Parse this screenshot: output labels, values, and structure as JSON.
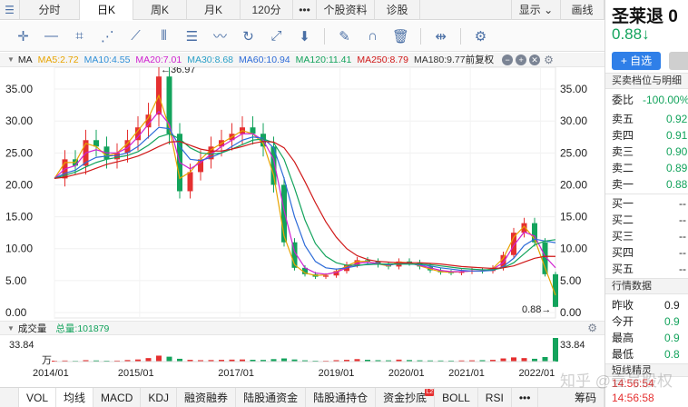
{
  "period_tabs": [
    "分时",
    "日K",
    "周K",
    "月K",
    "120分",
    "•••",
    "个股资料",
    "诊股"
  ],
  "period_active": "日K",
  "display_menu": {
    "label": "显示",
    "arrow": "⌄"
  },
  "draw_label": "画线",
  "toolbar_icons": [
    "crosshair-icon",
    "horizontal-line-icon",
    "crop-icon",
    "fan-icon",
    "ray-icon",
    "parallel-lines-icon",
    "channel-icon",
    "wave-icon",
    "cycle-icon",
    "gann-icon",
    "arrow-down-icon",
    "eraser-icon",
    "magnet-icon",
    "trash-icon",
    "zoom-icon",
    "settings-icon"
  ],
  "ma_legend": {
    "name": "MA",
    "items": [
      {
        "text": "MA5:2.72",
        "color": "#e8a400"
      },
      {
        "text": "MA10:4.55",
        "color": "#2f8fd8"
      },
      {
        "text": "MA20:7.01",
        "color": "#d020d0"
      },
      {
        "text": "MA30:8.68",
        "color": "#2aa0c8"
      },
      {
        "text": "MA60:10.94",
        "color": "#2d6bd8"
      },
      {
        "text": "MA120:11.41",
        "color": "#13a35c"
      },
      {
        "text": "MA250:8.79",
        "color": "#d01818"
      },
      {
        "text": "MA180:9.77",
        "color": "#333333"
      }
    ],
    "adjust": "前复权",
    "controls": [
      "−",
      "+",
      "✕"
    ]
  },
  "volume": {
    "title": "成交量",
    "total_label": "总量:101879",
    "max_value": "33.84",
    "unit": "万"
  },
  "chart_data": {
    "type": "line",
    "ylim": [
      0,
      37
    ],
    "y_ticks": [
      "35.00",
      "30.00",
      "25.00",
      "20.00",
      "15.00",
      "10.00",
      "5.00",
      "0.00"
    ],
    "x_ticks": [
      "2014/01",
      "2015/01",
      "2017/01",
      "2019/01",
      "2020/01",
      "2021/01",
      "2022/01"
    ],
    "annotations": [
      {
        "text": "←36.97"
      },
      {
        "text": "0.88→"
      }
    ],
    "series": [
      {
        "key": "close",
        "color": "#333333",
        "values": [
          21,
          24,
          23,
          27,
          26,
          24,
          25,
          27,
          29,
          31,
          36.97,
          28,
          19,
          22,
          24,
          26,
          27,
          28,
          29,
          28,
          26,
          20,
          11,
          7,
          6,
          5.6,
          5.8,
          6.5,
          7.5,
          8.2,
          8,
          7.5,
          7.2,
          8,
          7.8,
          7.2,
          6.6,
          6.3,
          6.2,
          6.4,
          6.6,
          6.5,
          7,
          9,
          12.5,
          14,
          11,
          6,
          0.88
        ]
      },
      {
        "key": "ma5",
        "color": "#e8a400",
        "values": [
          21,
          23.5,
          23.5,
          26.5,
          26,
          24.5,
          25,
          26.5,
          28.5,
          30.5,
          34,
          29,
          21,
          22,
          24,
          25.5,
          26.5,
          27.5,
          28.5,
          28,
          26.5,
          21.5,
          12,
          7.5,
          6.2,
          5.8,
          5.9,
          6.4,
          7.3,
          8,
          8,
          7.6,
          7.3,
          7.9,
          7.8,
          7.3,
          6.8,
          6.4,
          6.3,
          6.4,
          6.5,
          6.5,
          6.9,
          8.5,
          11.8,
          13.5,
          11.5,
          7,
          2.72
        ]
      },
      {
        "key": "ma20",
        "color": "#d020d0",
        "values": [
          21,
          22.5,
          23,
          25,
          25.5,
          25,
          25,
          25.8,
          27.5,
          29.5,
          31.5,
          29.5,
          23.5,
          22.5,
          23.5,
          24.8,
          26,
          27,
          28,
          28,
          27,
          24,
          16,
          9.5,
          7,
          6.2,
          6,
          6.3,
          7,
          7.7,
          7.9,
          7.7,
          7.4,
          7.7,
          7.7,
          7.4,
          7,
          6.6,
          6.4,
          6.4,
          6.5,
          6.5,
          6.8,
          7.8,
          10.5,
          12.6,
          12,
          8.8,
          7.01
        ]
      },
      {
        "key": "ma60",
        "color": "#2d6bd8",
        "values": [
          21,
          21.8,
          22.3,
          23.5,
          24.3,
          24.5,
          24.6,
          25,
          26,
          27.5,
          29,
          28.8,
          26,
          24,
          23.8,
          24.3,
          25,
          26,
          27,
          27.5,
          27.3,
          25.8,
          21,
          15,
          10.5,
          8,
          7,
          6.8,
          7,
          7.3,
          7.6,
          7.6,
          7.5,
          7.6,
          7.6,
          7.5,
          7.3,
          7,
          6.8,
          6.6,
          6.5,
          6.5,
          6.6,
          7.2,
          8.5,
          10.5,
          11.5,
          11.2,
          10.94
        ]
      },
      {
        "key": "ma120",
        "color": "#13a35c",
        "values": [
          21,
          21.5,
          22,
          22.8,
          23.5,
          24,
          24.3,
          24.6,
          25.2,
          26.2,
          27.5,
          28,
          27.2,
          25.8,
          25,
          24.8,
          25,
          25.6,
          26.3,
          27,
          27.2,
          26.6,
          24,
          19.5,
          14.5,
          10.8,
          8.8,
          7.8,
          7.4,
          7.4,
          7.5,
          7.6,
          7.6,
          7.6,
          7.6,
          7.6,
          7.5,
          7.3,
          7.1,
          6.9,
          6.8,
          6.7,
          6.7,
          7,
          7.8,
          9.2,
          10.6,
          11.2,
          11.41
        ]
      },
      {
        "key": "ma250",
        "color": "#d01818",
        "values": [
          21,
          21.2,
          21.6,
          22,
          22.6,
          23.2,
          23.6,
          24,
          24.5,
          25.2,
          26,
          26.7,
          26.8,
          26.2,
          25.6,
          25.3,
          25.3,
          25.6,
          26,
          26.5,
          26.8,
          26.7,
          25.8,
          23.6,
          20.5,
          17.2,
          14.2,
          11.8,
          10,
          8.9,
          8.3,
          8,
          7.9,
          7.8,
          7.8,
          7.8,
          7.7,
          7.6,
          7.4,
          7.2,
          7.1,
          7,
          6.9,
          7,
          7.3,
          7.9,
          8.5,
          8.8,
          8.79
        ]
      }
    ],
    "volume": [
      1.2,
      1.5,
      1.1,
      2,
      1.6,
      1.3,
      1.4,
      2.2,
      3,
      5,
      8.5,
      7,
      4,
      2.5,
      2,
      2.2,
      2.5,
      2.8,
      3,
      2.6,
      2.4,
      3.5,
      4.5,
      3,
      1.8,
      1.3,
      1.2,
      2,
      2.5,
      3.5,
      2.6,
      2,
      1.8,
      2.8,
      2.2,
      1.8,
      1.6,
      1.5,
      1.4,
      1.6,
      1.8,
      2,
      2.5,
      4.5,
      6,
      5,
      4,
      6.5,
      33.84
    ]
  },
  "stock": {
    "name": "圣莱退",
    "code_partial": "0",
    "price": "0.88",
    "arrow": "↓"
  },
  "right_buttons": {
    "add": "+ 自选"
  },
  "order_book": {
    "title": "买卖档位与明细",
    "ratio_label": "委比",
    "ratio_value": "-100.00%",
    "sell": [
      {
        "label": "卖五",
        "price": "0.92"
      },
      {
        "label": "卖四",
        "price": "0.91"
      },
      {
        "label": "卖三",
        "price": "0.90"
      },
      {
        "label": "卖二",
        "price": "0.89"
      },
      {
        "label": "卖一",
        "price": "0.88"
      }
    ],
    "buy": [
      {
        "label": "买一",
        "price": "--"
      },
      {
        "label": "买二",
        "price": "--"
      },
      {
        "label": "买三",
        "price": "--"
      },
      {
        "label": "买四",
        "price": "--"
      },
      {
        "label": "买五",
        "price": "--"
      }
    ]
  },
  "quote": {
    "title": "行情数据",
    "rows": [
      {
        "label": "昨收",
        "value": "0.9"
      },
      {
        "label": "今开",
        "value": "0.9"
      },
      {
        "label": "最高",
        "value": "0.9"
      },
      {
        "label": "最低",
        "value": "0.8"
      }
    ]
  },
  "ticks": {
    "title": "短线精灵",
    "times": [
      "14:56:54",
      "14:56:58"
    ]
  },
  "indicator_tabs": [
    "VOL",
    "均线",
    "MACD",
    "KDJ",
    "融资融券",
    "陆股通资金",
    "陆股通持仓",
    "资金抄底",
    "BOLL",
    "RSI",
    "•••"
  ],
  "indicator_active": [
    "VOL",
    "均线"
  ],
  "badge_text": "L2",
  "chip_label": "筹码",
  "watermark": "知乎 @壹号股权"
}
